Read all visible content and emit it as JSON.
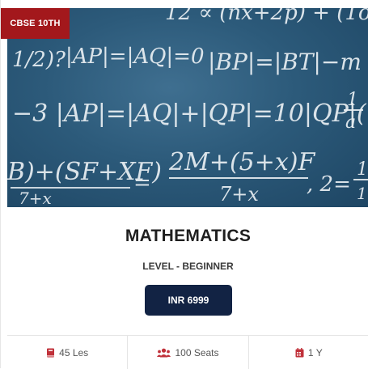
{
  "card": {
    "badge": "CBSE 10TH",
    "title": "MATHEMATICS",
    "level": "LEVEL - BEGINNER",
    "price": "INR 6999",
    "stats": [
      {
        "icon": "book-icon",
        "label": "45 Les"
      },
      {
        "icon": "users-icon",
        "label": "100 Seats"
      },
      {
        "icon": "calendar-icon",
        "label": "1 Y"
      }
    ]
  },
  "colors": {
    "badge": "#a3181c",
    "price_button": "#122344",
    "icon_accent": "#c0313a",
    "chalkboard": "#2c5a7a"
  }
}
